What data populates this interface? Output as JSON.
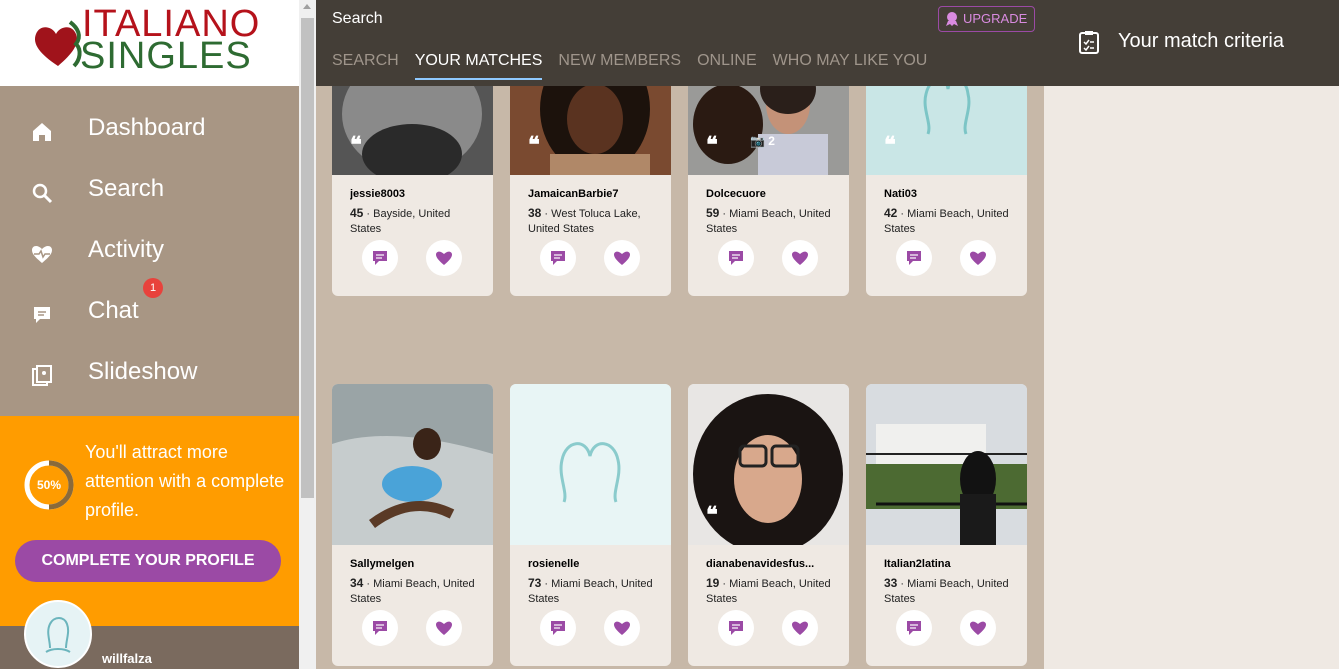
{
  "logo": {
    "line1": "ITALIANO",
    "line2": "SINGLES"
  },
  "nav": [
    {
      "label": "Dashboard",
      "icon": "home-icon"
    },
    {
      "label": "Search",
      "icon": "search-icon"
    },
    {
      "label": "Activity",
      "icon": "heartbeat-icon"
    },
    {
      "label": "Chat",
      "icon": "chat-icon",
      "badge": "1"
    },
    {
      "label": "Slideshow",
      "icon": "slideshow-icon"
    }
  ],
  "promo": {
    "progress": "50%",
    "text": "You'll attract more attention with a complete profile.",
    "button": "COMPLETE YOUR PROFILE"
  },
  "user": {
    "name": "willfalza"
  },
  "header": {
    "title": "Search",
    "upgrade": "UPGRADE",
    "tabs": [
      "SEARCH",
      "YOUR MATCHES",
      "NEW MEMBERS",
      "ONLINE",
      "WHO MAY LIKE YOU"
    ],
    "active_tab": "YOUR MATCHES",
    "criteria": "Your match criteria"
  },
  "colors": {
    "accent": "#9b4aa5",
    "promo": "#ff9c00",
    "header": "#443e37"
  },
  "cards": [
    {
      "name": "jessie8003",
      "age": "45",
      "location": "Bayside, United States",
      "quote": true
    },
    {
      "name": "JamaicanBarbie7",
      "age": "38",
      "location": "West Toluca Lake, United States",
      "quote": true
    },
    {
      "name": "Dolcecuore",
      "age": "59",
      "location": "Miami Beach, United States",
      "quote": true,
      "photos": "2"
    },
    {
      "name": "Nati03",
      "age": "42",
      "location": "Miami Beach, United States",
      "quote": true
    },
    {
      "name": "Sallymelgen",
      "age": "34",
      "location": "Miami Beach, United States"
    },
    {
      "name": "rosienelle",
      "age": "73",
      "location": "Miami Beach, United States"
    },
    {
      "name": "dianabenavidesfus...",
      "age": "19",
      "location": "Miami Beach, United States",
      "quote": true
    },
    {
      "name": "Italian2latina",
      "age": "33",
      "location": "Miami Beach, United States"
    }
  ]
}
